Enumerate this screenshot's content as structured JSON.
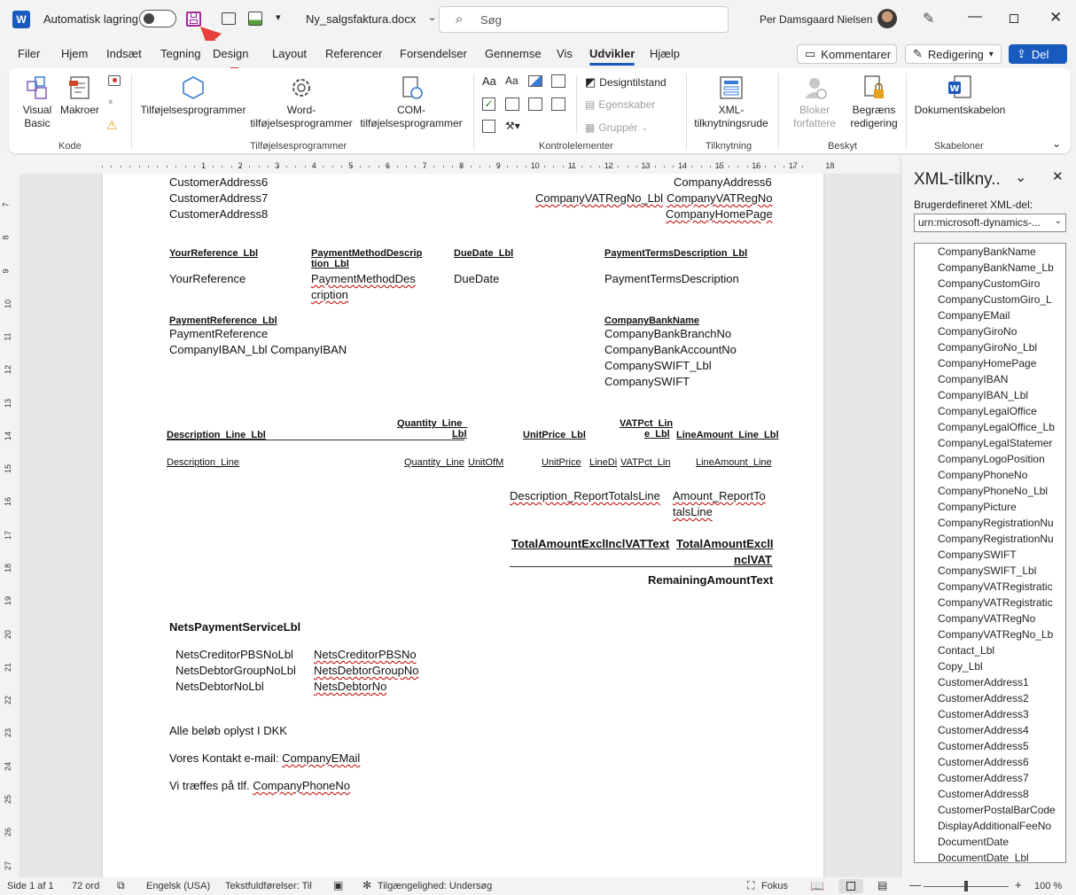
{
  "titlebar": {
    "autosave_label": "Automatisk lagring",
    "filename": "Ny_salgsfaktura.docx",
    "search_placeholder": "Søg",
    "user_name": "Per Damsgaard Nielsen"
  },
  "tabs": [
    "Filer",
    "Hjem",
    "Indsæt",
    "Tegning",
    "Design",
    "Layout",
    "Referencer",
    "Forsendelser",
    "Gennemse",
    "Vis",
    "Udvikler",
    "Hjælp"
  ],
  "actions": {
    "comments": "Kommentarer",
    "editing": "Redigering",
    "share": "Del"
  },
  "ribbon": {
    "code": {
      "label": "Kode",
      "visual_basic": [
        "Visual",
        "Basic"
      ],
      "macros": "Makroer"
    },
    "addins": {
      "label": "Tilføjelsesprogrammer",
      "addins": "Tilføjelsesprogrammer",
      "word": [
        "Word-",
        "tilføjelsesprogrammer"
      ],
      "com": [
        "COM-",
        "tilføjelsesprogrammer"
      ]
    },
    "controls": {
      "label": "Kontrolelementer",
      "design_mode": "Designtilstand",
      "properties": "Egenskaber",
      "group": "Gruppér"
    },
    "mapping": {
      "label": "Tilknytning",
      "xml": [
        "XML-",
        "tilknytningsrude"
      ]
    },
    "protect": {
      "label": "Beskyt",
      "block": [
        "Bloker",
        "forfattere"
      ],
      "restrict": [
        "Begræns",
        "redigering"
      ]
    },
    "templates": {
      "label": "Skabeloner",
      "doc_template": "Dokumentskabelon"
    }
  },
  "ruler_numbers": [
    "1",
    "2",
    "3",
    "4",
    "5",
    "6",
    "7",
    "8",
    "9",
    "10",
    "11",
    "12",
    "13",
    "14",
    "15",
    "16",
    "17",
    "18"
  ],
  "vruler_numbers": [
    "7",
    "8",
    "9",
    "10",
    "11",
    "12",
    "13",
    "14",
    "15",
    "16",
    "17",
    "18",
    "19",
    "20",
    "21",
    "22",
    "23",
    "24",
    "25",
    "26",
    "27"
  ],
  "document": {
    "cust6": "CustomerAddress6",
    "cust7": "CustomerAddress7",
    "cust8": "CustomerAddress8",
    "comp6": "CompanyAddress6",
    "vat_lbl": "CompanyVATRegNo_Lbl",
    "vat": "CompanyVATRegNo",
    "homepage": "CompanyHomePage",
    "yourref_lbl": "YourReference_Lbl",
    "paymeth_lbl1": "PaymentMethodDescrip",
    "paymeth_lbl2": "tion_Lbl",
    "duedate_lbl": "DueDate_Lbl",
    "payterms_lbl": "PaymentTermsDescription_Lbl",
    "yourref": "YourReference",
    "paymeth1": "PaymentMethodDes",
    "paymeth2": "cription",
    "duedate": "DueDate",
    "payterms": "PaymentTermsDescription",
    "payref_lbl": "PaymentReference_Lbl",
    "payref": "PaymentReference",
    "iban": "CompanyIBAN_Lbl CompanyIBAN",
    "bankname": "CompanyBankName",
    "branch": "CompanyBankBranchNo",
    "account": "CompanyBankAccountNo",
    "swift_lbl": "CompanySWIFT_Lbl",
    "swift": "CompanySWIFT",
    "qty_lbl1": "Quantity_Line_",
    "qty_lbl2": "Lbl",
    "desc_lbl": "Description_Line_Lbl",
    "unitprice_lbl": "UnitPrice_Lbl",
    "vatpct_lbl1": "VATPct_Lin",
    "vatpct_lbl2": "e_Lbl",
    "lineamt_lbl": "LineAmount_Line_Lbl",
    "desc_line": "Description_Line",
    "qty_line": "Quantity_Line",
    "uom": "UnitOfM",
    "unitprice": "UnitPrice",
    "linedisc": "LineDi",
    "vatpct": "VATPct_Lin",
    "lineamt": "LineAmount_Line",
    "totals_desc": "Description_ReportTotalsLine",
    "totals_amt1": "Amount_ReportTo",
    "totals_amt2": "talsLine",
    "total_text": "TotalAmountExclInclVATText",
    "total_amt1": "TotalAmountExclI",
    "total_amt2": "nclVAT",
    "remaining": "RemainingAmountText",
    "nets": "NetsPaymentServiceLbl",
    "nets1_lbl": "NetsCreditorPBSNoLbl",
    "nets1": "NetsCreditorPBSNo",
    "nets2_lbl": "NetsDebtorGroupNoLbl",
    "nets2": "NetsDebtorGroupNo",
    "nets3_lbl": "NetsDebtorNoLbl",
    "nets3": "NetsDebtorNo",
    "dkk": "Alle beløb oplyst I DKK",
    "contact_prefix": "Vores Kontakt e-mail: ",
    "contact_val": "CompanyEMail",
    "phone_prefix": "Vi træffes på tlf. ",
    "phone_val": "CompanyPhoneNo"
  },
  "xml_pane": {
    "title": "XML-tilkny..",
    "part_label": "Brugerdefineret XML-del:",
    "part_value": "urn:microsoft-dynamics-...",
    "items": [
      "CompanyBankName",
      "CompanyBankName_Lb",
      "CompanyCustomGiro",
      "CompanyCustomGiro_L",
      "CompanyEMail",
      "CompanyGiroNo",
      "CompanyGiroNo_Lbl",
      "CompanyHomePage",
      "CompanyIBAN",
      "CompanyIBAN_Lbl",
      "CompanyLegalOffice",
      "CompanyLegalOffice_Lb",
      "CompanyLegalStatemer",
      "CompanyLogoPosition",
      "CompanyPhoneNo",
      "CompanyPhoneNo_Lbl",
      "CompanyPicture",
      "CompanyRegistrationNu",
      "CompanyRegistrationNu",
      "CompanySWIFT",
      "CompanySWIFT_Lbl",
      "CompanyVATRegistratic",
      "CompanyVATRegistratic",
      "CompanyVATRegNo",
      "CompanyVATRegNo_Lb",
      "Contact_Lbl",
      "Copy_Lbl",
      "CustomerAddress1",
      "CustomerAddress2",
      "CustomerAddress3",
      "CustomerAddress4",
      "CustomerAddress5",
      "CustomerAddress6",
      "CustomerAddress7",
      "CustomerAddress8",
      "CustomerPostalBarCode",
      "DisplayAdditionalFeeNo",
      "DocumentDate",
      "DocumentDate_Lbl"
    ]
  },
  "status": {
    "page": "Side 1 af 1",
    "words": "72 ord",
    "language": "Engelsk (USA)",
    "predictions": "Tekstfuldførelser: Til",
    "accessibility": "Tilgængelighed: Undersøg",
    "focus": "Fokus",
    "zoom": "100 %"
  },
  "colors": {
    "accent": "#185abd",
    "squiggle": "#c00000",
    "arrow": "#e8403a",
    "save_icon": "#a2299d"
  }
}
